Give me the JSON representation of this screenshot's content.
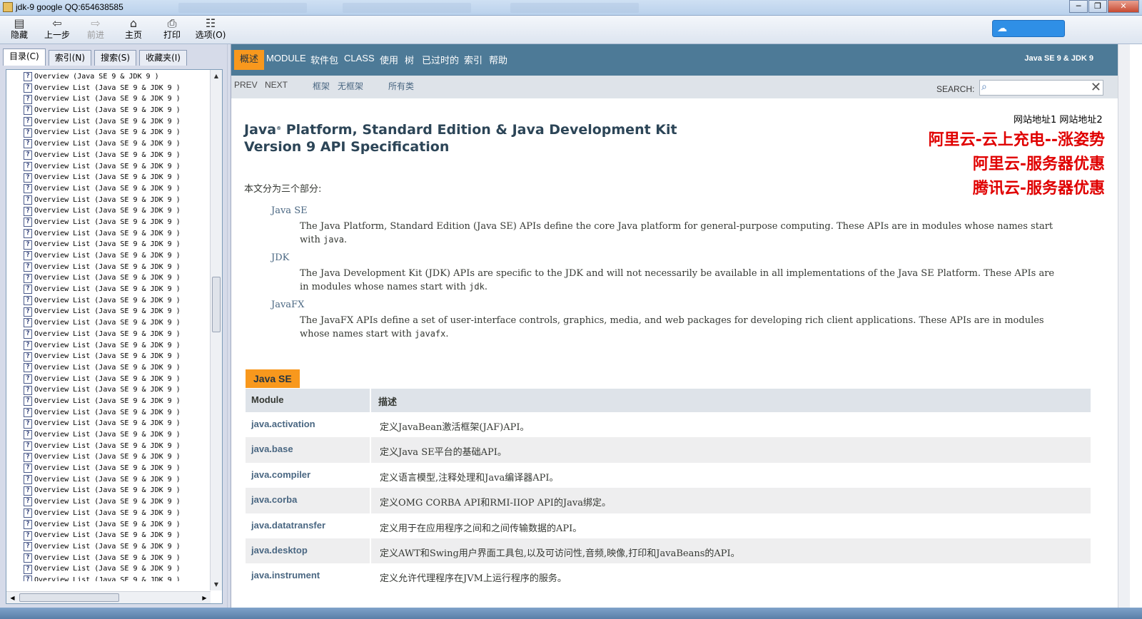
{
  "window": {
    "title": "jdk-9 google QQ:654638585"
  },
  "toolbar": [
    {
      "label": "隐藏",
      "icon": "hide-icon",
      "disabled": false
    },
    {
      "label": "上一步",
      "icon": "back-arrow-icon",
      "disabled": false
    },
    {
      "label": "前进",
      "icon": "forward-arrow-icon",
      "disabled": true
    },
    {
      "label": "主页",
      "icon": "home-icon",
      "disabled": false
    },
    {
      "label": "打印",
      "icon": "print-icon",
      "disabled": false
    },
    {
      "label": "选项(O)",
      "icon": "options-icon",
      "disabled": false
    }
  ],
  "left": {
    "tabs": [
      "目录(C)",
      "索引(N)",
      "搜索(S)",
      "收藏夹(I)"
    ],
    "first_item": "Overview (Java SE 9 & JDK 9 )",
    "repeat_item": "Overview List (Java SE 9 & JDK 9 )",
    "repeat_count": 45
  },
  "nav": {
    "items": [
      "概述",
      "MODULE",
      "软件包",
      "CLASS",
      "使用",
      "树",
      "已过时的",
      "索引",
      "帮助"
    ],
    "brand": "Java SE 9 & JDK 9"
  },
  "subnav": {
    "prev": "PREV",
    "next": "NEXT",
    "frames": "框架",
    "noframes": "无框架",
    "allclasses": "所有类",
    "search_label": "SEARCH:",
    "search_value": ""
  },
  "ads": {
    "links": "网站地址1 网站地址2",
    "lines": [
      "阿里云-云上充电--涨姿势",
      "阿里云-服务器优惠",
      "腾讯云-服务器优惠"
    ]
  },
  "main": {
    "title_line1_a": "Java",
    "title_sup": "®",
    "title_line1_b": " Platform, Standard Edition & Java Development Kit",
    "title_line2": "Version 9 API Specification",
    "intro": "本文分为三个部分:",
    "sections": [
      {
        "term": "Java SE",
        "desc_pre": "The Java Platform, Standard Edition (Java SE) APIs define the core Java platform for general-purpose computing. These APIs are in modules whose names start with ",
        "code": "java",
        "desc_post": "."
      },
      {
        "term": "JDK",
        "desc_pre": "The Java Development Kit (JDK) APIs are specific to the JDK and will not necessarily be available in all implementations of the Java SE Platform. These APIs are in modules whose names start with ",
        "code": "jdk",
        "desc_post": "."
      },
      {
        "term": "JavaFX",
        "desc_pre": "The JavaFX APIs define a set of user-interface controls, graphics, media, and web packages for developing rich client applications. These APIs are in modules whose names start with ",
        "code": "javafx",
        "desc_post": "."
      }
    ],
    "table": {
      "caption": "Java SE",
      "headers": [
        "Module",
        "描述"
      ],
      "rows": [
        {
          "module": "java.activation",
          "desc": "定义JavaBean激活框架(JAF)API。"
        },
        {
          "module": "java.base",
          "desc": "定义Java SE平台的基础API。"
        },
        {
          "module": "java.compiler",
          "desc": "定义语言模型,注释处理和Java编译器API。"
        },
        {
          "module": "java.corba",
          "desc": "定义OMG CORBA API和RMI-IIOP API的Java绑定。"
        },
        {
          "module": "java.datatransfer",
          "desc": "定义用于在应用程序之间和之间传输数据的API。"
        },
        {
          "module": "java.desktop",
          "desc": "定义AWT和Swing用户界面工具包,以及可访问性,音频,映像,打印和JavaBeans的API。"
        },
        {
          "module": "java.instrument",
          "desc": "定义允许代理程序在JVM上运行程序的服务。"
        }
      ]
    }
  },
  "colors": {
    "nav_bg": "#4d7a97",
    "accent": "#f8981d",
    "subnav_bg": "#dee3e9",
    "link": "#4a6782",
    "ad_red": "#e00000"
  }
}
